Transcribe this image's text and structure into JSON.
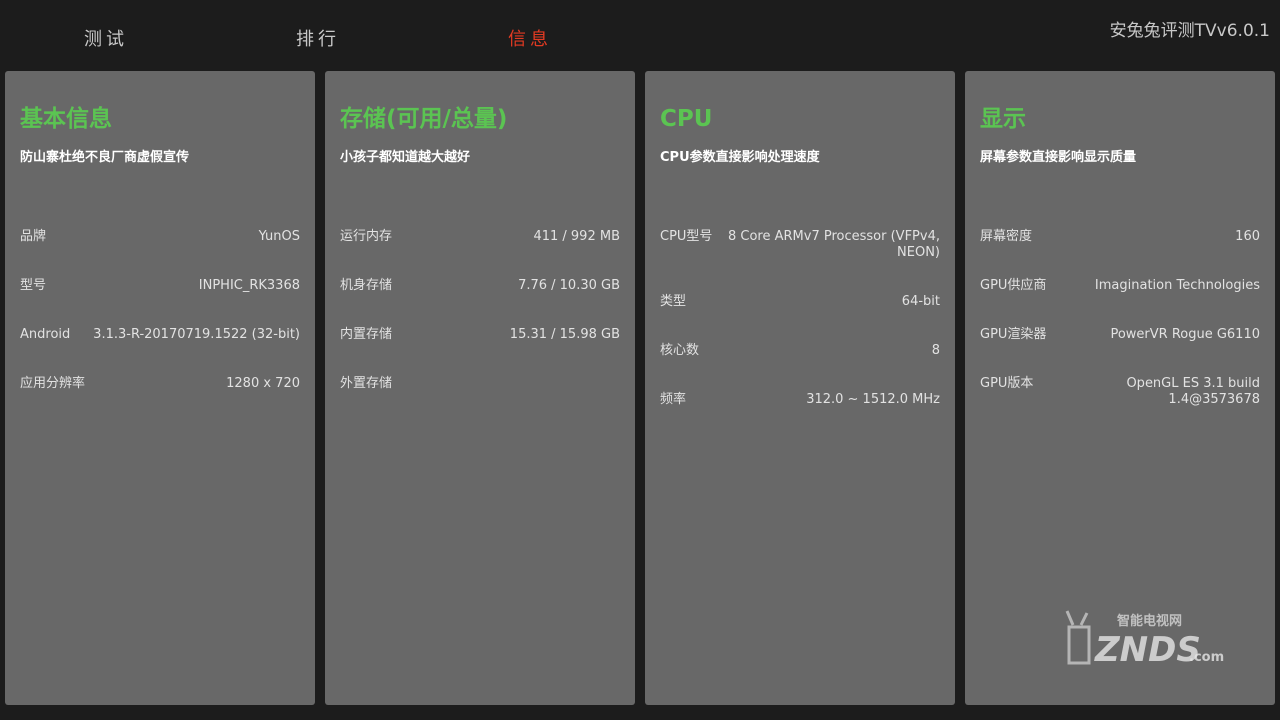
{
  "tabs": [
    {
      "label": "测试",
      "active": false
    },
    {
      "label": "排行",
      "active": false
    },
    {
      "label": "信息",
      "active": true
    }
  ],
  "app_title": "安兔兔评测TVv6.0.1",
  "panels": [
    {
      "title": "基本信息",
      "subtitle": "防山寨杜绝不良厂商虚假宣传",
      "rows": [
        {
          "key": "品牌",
          "value": "YunOS"
        },
        {
          "key": "型号",
          "value": "INPHIC_RK3368"
        },
        {
          "key": "Android",
          "value": "3.1.3-R-20170719.1522 (32-bit)"
        },
        {
          "key": "应用分辨率",
          "value": "1280 x 720"
        }
      ]
    },
    {
      "title": "存储(可用/总量)",
      "subtitle": "小孩子都知道越大越好",
      "rows": [
        {
          "key": "运行内存",
          "value": "411 / 992 MB"
        },
        {
          "key": "机身存储",
          "value": "7.76 / 10.30 GB"
        },
        {
          "key": "内置存储",
          "value": "15.31 / 15.98 GB"
        },
        {
          "key": "外置存储",
          "value": ""
        }
      ]
    },
    {
      "title": "CPU",
      "subtitle": "CPU参数直接影响处理速度",
      "rows": [
        {
          "key": "CPU型号",
          "value": "8 Core ARMv7 Processor (VFPv4, NEON)"
        },
        {
          "key": "类型",
          "value": "64-bit"
        },
        {
          "key": "核心数",
          "value": "8"
        },
        {
          "key": "频率",
          "value": "312.0 ~ 1512.0 MHz"
        }
      ]
    },
    {
      "title": "显示",
      "subtitle": "屏幕参数直接影响显示质量",
      "rows": [
        {
          "key": "屏幕密度",
          "value": "160"
        },
        {
          "key": "GPU供应商",
          "value": "Imagination Technologies"
        },
        {
          "key": "GPU渲染器",
          "value": "PowerVR Rogue G6110"
        },
        {
          "key": "GPU版本",
          "value": "OpenGL ES 3.1 build 1.4@3573678"
        }
      ]
    }
  ],
  "watermark": {
    "top_text": "智能电视网",
    "brand": "ZNDS",
    "suffix": ".com"
  },
  "colors": {
    "accent_green": "#5bc452",
    "active_tab_red": "#e23a22",
    "panel_bg": "#686868",
    "page_bg": "#1c1c1c"
  }
}
